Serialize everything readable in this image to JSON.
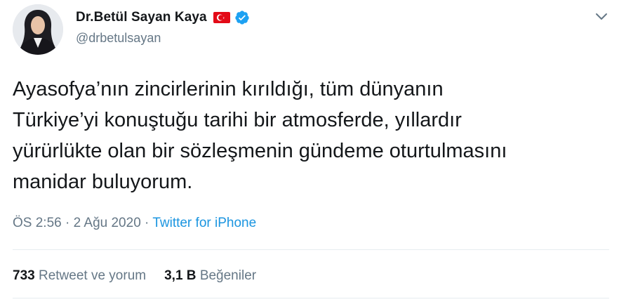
{
  "author": {
    "display_name": "Dr.Betül Sayan Kaya",
    "handle": "@drbetulsayan",
    "flag_icon": "turkey-flag-icon",
    "verified_icon": "verified-badge-icon"
  },
  "menu": {
    "icon": "chevron-down-icon"
  },
  "tweet": {
    "text": "Ayasofya’nın zincirlerinin kırıldığı, tüm dünyanın\nTürkiye’yi konuştuğu tarihi bir atmosferde, yıllardır\nyürürlükte olan bir sözleşmenin gündeme oturtulmasını\nmanidar buluyorum."
  },
  "meta": {
    "time": "ÖS 2:56",
    "separator1": " · ",
    "date": "2 Ağu 2020",
    "separator2": " · ",
    "source": "Twitter for iPhone"
  },
  "stats": {
    "retweets_count": "733",
    "retweets_label": "Retweet ve yorum",
    "likes_count": "3,1 B",
    "likes_label": "Beğeniler"
  },
  "colors": {
    "link": "#1b95e0",
    "muted": "#657786",
    "text": "#14171a",
    "divider": "#e6ecf0",
    "verified": "#1da1f2",
    "flag_red": "#e30a17"
  }
}
